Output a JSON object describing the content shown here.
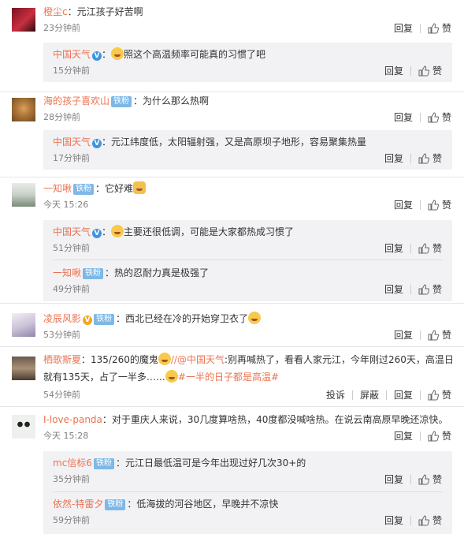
{
  "labels": {
    "reply": "回复",
    "like": "赞",
    "report": "投诉",
    "block": "屏蔽"
  },
  "colors": {
    "username": "#eb7350",
    "badge": "#7db8e8",
    "reply_bg": "#f2f2f5",
    "time": "#808080"
  },
  "icons": {
    "like": "thumbs-up-icon",
    "verified": "verified-v-icon",
    "emoji": "laughing-emoji-icon"
  },
  "comments": [
    {
      "user": "橙尘c",
      "text": "：元江孩子好苦啊",
      "time": "23分钟前",
      "replies": [
        {
          "user": "中国天气",
          "text": "照这个高温频率可能真的习惯了吧",
          "time": "15分钟前"
        }
      ]
    },
    {
      "user": "海的孩子喜欢山",
      "badge": "铁粉",
      "text": "：为什么那么热啊",
      "time": "28分钟前",
      "replies": [
        {
          "user": "中国天气",
          "text": "：元江纬度低，太阳辐射强，又是高原坝子地形，容易聚集热量",
          "time": "17分钟前"
        }
      ]
    },
    {
      "user": "一知啾",
      "badge": "铁粉",
      "text": "：它好难",
      "time": "今天 15:26",
      "replies": [
        {
          "user": "中国天气",
          "text": "主要还很低调，可能是大家都热成习惯了",
          "time": "51分钟前"
        },
        {
          "user": "一知啾",
          "badge": "铁粉",
          "text": "：热的忍耐力真是极强了",
          "time": "49分钟前"
        }
      ]
    },
    {
      "user": "凌辰风影",
      "badge": "铁粉",
      "text": "：西北已经在冷的开始穿卫衣了",
      "time": "53分钟前"
    },
    {
      "user": "栖歌斯夏",
      "text1": "：135/260的魔鬼",
      "text2": "//@中国天气",
      "text3": ":别再喊热了，看看人家元江，今年刚过260天，高温日就有135天，占了一半多……",
      "hashtag": "#一半的日子都是高温#",
      "time": "54分钟前"
    },
    {
      "user": "I-love-panda",
      "text": "：对于重庆人来说，30几度算啥热，40度都没喊啥热。在说云南高原早晚还凉快。",
      "time": "今天 15:28",
      "replies": [
        {
          "user": "mc信标6",
          "badge": "铁粉",
          "text": "：元江日最低温可是今年出现过好几次30+的",
          "time": "35分钟前"
        },
        {
          "user": "依然-特雷夕",
          "badge": "铁粉",
          "text": "：低海拔的河谷地区，早晚并不凉快",
          "time": "59分钟前"
        }
      ]
    }
  ]
}
